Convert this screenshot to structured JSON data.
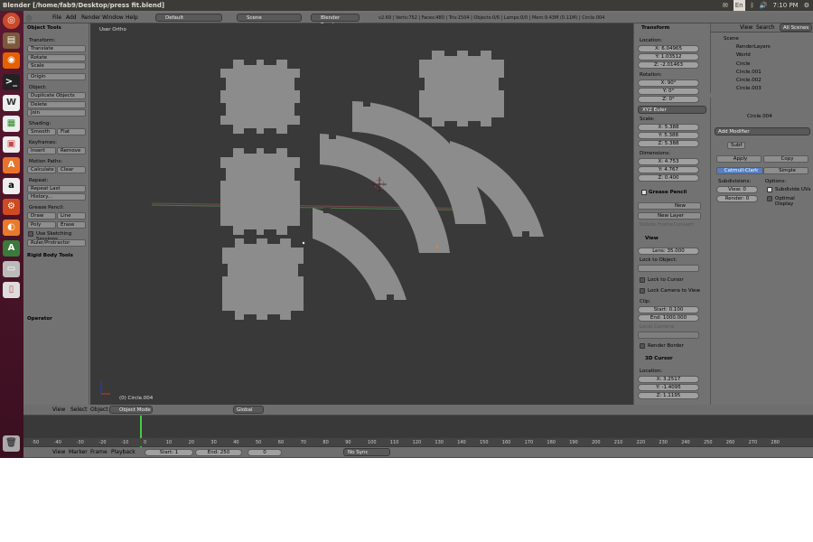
{
  "window_title": "Blender [/home/fab9/Desktop/press fit.blend]",
  "tray": {
    "lang": "En",
    "time": "7:10 PM"
  },
  "menu": [
    "File",
    "Add",
    "Render",
    "Window",
    "Help"
  ],
  "layout_name": "Default",
  "scene_name": "Scene",
  "render_engine": "Blender Render",
  "stats": "v2.69 | Verts:752 | Faces:480 | Tris:1504 | Objects:0/6 | Lamps:0/0 | Mem:9.43M (0.11M) | Circle.004",
  "tools": {
    "title": "Object Tools",
    "transform_label": "Transform:",
    "translate": "Translate",
    "rotate": "Rotate",
    "scale": "Scale",
    "origin": "Origin",
    "object_label": "Object:",
    "duplicate": "Duplicate Objects",
    "delete": "Delete",
    "join": "Join",
    "shading_label": "Shading:",
    "smooth": "Smooth",
    "flat": "Flat",
    "keyframes_label": "Keyframes:",
    "insert": "Insert",
    "remove": "Remove",
    "motion_label": "Motion Paths:",
    "calculate": "Calculate",
    "clear": "Clear",
    "repeat_label": "Repeat:",
    "repeat_last": "Repeat Last",
    "history": "History...",
    "gp_label": "Grease Pencil:",
    "draw": "Draw",
    "line": "Line",
    "poly": "Poly",
    "erase": "Erase",
    "sketch": "Use Sketching Sessions",
    "ruler": "Ruler/Protractor",
    "rigid": "Rigid Body Tools",
    "operator": "Operator"
  },
  "viewport": {
    "view_label": "User Ortho",
    "object_label": "(0) Circle.004"
  },
  "properties": {
    "transform_title": "Transform",
    "location_label": "Location:",
    "loc_x": "X: 6.04965",
    "loc_y": "Y: 1.03512",
    "loc_z": "Z: -2.01463",
    "rotation_label": "Rotation:",
    "rot_x": "X: 90°",
    "rot_y": "Y: 0°",
    "rot_z": "Z: 0°",
    "rot_mode": "XYZ Euler",
    "scale_label": "Scale:",
    "sc_x": "X: 5.388",
    "sc_y": "Y: 5.388",
    "sc_z": "Z: 5.388",
    "dim_label": "Dimensions:",
    "dim_x": "X: 4.753",
    "dim_y": "Y: 4.767",
    "dim_z": "Z: 0.400",
    "gp_title": "Grease Pencil",
    "gp_new": "New",
    "gp_new_layer": "New Layer",
    "gp_delete_frame": "Delete Frame",
    "gp_convert": "Convert",
    "view_title": "View",
    "lens": "Lens: 35.000",
    "lock_obj": "Lock to Object:",
    "lock_cursor": "Lock to Cursor",
    "lock_camera": "Lock Camera to View",
    "clip_label": "Clip:",
    "clip_start": "Start: 0.100",
    "clip_end": "End: 1000.000",
    "local_camera": "Local Camera:",
    "render_border": "Render Border",
    "cursor_title": "3D Cursor",
    "cursor_location": "Location:",
    "cur_x": "X: 3.2517",
    "cur_y": "Y: -1.4095",
    "cur_z": "Z: 1.1195"
  },
  "outliner": {
    "view": "View",
    "search": "Search",
    "filter": "All Scenes",
    "items": [
      "Scene",
      "RenderLayers",
      "World",
      "Circle",
      "Circle.001",
      "Circle.002",
      "Circle.003"
    ]
  },
  "modifiers": {
    "object_name": "Circle.004",
    "add_modifier": "Add Modifier",
    "mod_name": "Subf",
    "apply": "Apply",
    "copy": "Copy",
    "catmull": "Catmull-Clark",
    "simple": "Simple",
    "subdivisions": "Subdivisions:",
    "options": "Options:",
    "view_level": "View: 0",
    "render_level": "Render: 0",
    "subdivide_uvs": "Subdivide UVs",
    "optimal_display": "Optimal Display"
  },
  "vp_header": {
    "view": "View",
    "select": "Select",
    "object": "Object",
    "mode": "Object Mode",
    "orientation": "Global"
  },
  "timeline": {
    "ticks": [
      "-50",
      "-40",
      "-30",
      "-20",
      "-10",
      "0",
      "10",
      "20",
      "30",
      "40",
      "50",
      "60",
      "70",
      "80",
      "90",
      "100",
      "110",
      "120",
      "130",
      "140",
      "150",
      "160",
      "170",
      "180",
      "190",
      "200",
      "210",
      "220",
      "230",
      "240",
      "250",
      "260",
      "270",
      "280"
    ],
    "view": "View",
    "marker": "Marker",
    "frame": "Frame",
    "playback": "Playback",
    "start": "Start: 1",
    "end": "End: 250",
    "current": "0",
    "sync": "No Sync"
  },
  "colors": {
    "viewport_bg": "#393939",
    "panel_bg": "#727272",
    "piece": "#8c8c8c",
    "launcher": "#4a1428",
    "accent": "#5680c2"
  }
}
